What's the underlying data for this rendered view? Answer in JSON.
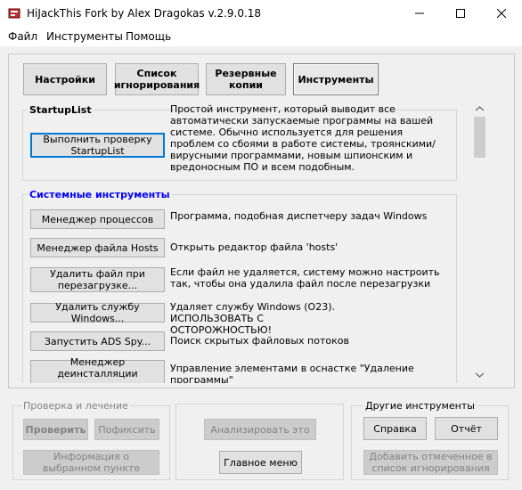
{
  "window": {
    "title": "HiJackThis Fork by Alex Dragokas v.2.9.0.18"
  },
  "menu": [
    "Файл",
    "Инструменты",
    "Помощь"
  ],
  "tabs": [
    {
      "label": "Настройки"
    },
    {
      "label": "Список игнорирования"
    },
    {
      "label": "Резервные копии"
    },
    {
      "label": "Инструменты",
      "active": true
    }
  ],
  "startuplist": {
    "header": "StartupList",
    "button": "Выполнить проверку StartupList",
    "description": "Простой инструмент, который выводит все автоматически запускаемые программы на вашей системе. Обычно используется для решения проблем со сбоями в работе системы, троянскими/вирусными программами, новым шпионским и вредоносным ПО и всем подобным."
  },
  "system_tools": {
    "header": "Системные инструменты",
    "items": [
      {
        "button": "Менеджер процессов",
        "description": "Программа, подобная диспетчеру задач Windows"
      },
      {
        "button": "Менеджер файла Hosts",
        "description": "Открыть редактор файла 'hosts'"
      },
      {
        "button": "Удалить файл при перезагрузке...",
        "description": "Если файл не удаляется, систему можно настроить так, чтобы она удалила файл после перезагрузки"
      },
      {
        "button": "Удалить службу Windows...",
        "description": "Удаляет службу Windows (O23). ИСПОЛЬЗОВАТЬ С ОСТОРОЖНОСТЬЮ!"
      },
      {
        "button": "Запустить ADS Spy...",
        "description": "Поиск скрытых файловых потоков"
      },
      {
        "button": "Менеджер деинсталляции программ",
        "description": "Управление элементами в оснастке \"Удаление программы\""
      }
    ]
  },
  "bottom": {
    "check_group": {
      "label": "Проверка и лечение",
      "scan": "Проверить",
      "fix": "Пофиксить",
      "info": "Информация о выбранном пункте"
    },
    "middle": {
      "analyze": "Анализировать это",
      "main_menu": "Главное меню"
    },
    "other_group": {
      "label": "Другие инструменты",
      "help": "Справка",
      "report": "Отчёт",
      "add_ignore": "Добавить отмеченное в список игнорирования"
    }
  },
  "colors": {
    "accent_header": "#0000ff",
    "focus_border": "#0078d7"
  }
}
